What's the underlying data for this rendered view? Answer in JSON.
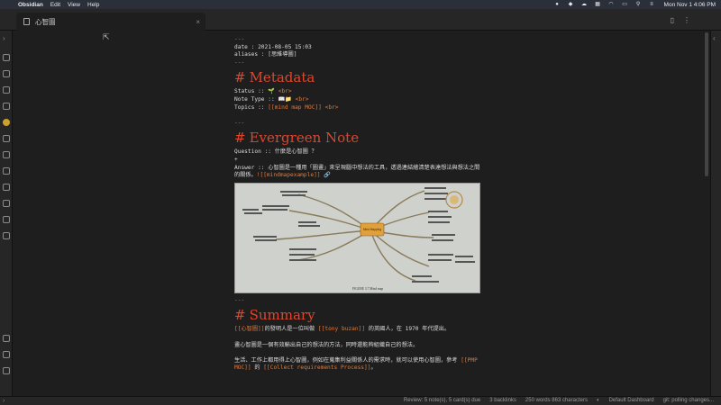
{
  "menubar": {
    "apple_icon": "apple-icon",
    "app_name": "Obsidian",
    "items": [
      "Edit",
      "View",
      "Help"
    ],
    "clock": "Mon Nov 1  4:06 PM"
  },
  "tab": {
    "title": "心智圖",
    "close": "×"
  },
  "note": {
    "frontmatter_open": "---",
    "date_line": "date : 2021-08-05 15:03",
    "aliases_line": "aliases : [思維導圖]",
    "frontmatter_close": "---",
    "h_metadata": "Metadata",
    "status_label": "Status :: ",
    "status_value": "🌱",
    "note_type_label": "Note Type :: ",
    "note_type_value": "📖📁",
    "topics_label": "Topics :: ",
    "topics_link": "[[mind map MOC]]",
    "br": "<br>",
    "sep1": "---",
    "h_evergreen": "Evergreen Note",
    "question_line": "Question :: 什麼是心智圖 ？",
    "plus": "+",
    "answer_line": "Answer :: 心智圖是一種用「圖畫」來呈現腦中想法的工具，透過連結繪清楚表達想法與想法之間的關係。",
    "answer_link": "![[mindmapexample]]",
    "sep2": "---",
    "h_summary": "Summary",
    "summary_1_link1": "[[心智圖]]",
    "summary_1_text1": "的發明人是一位叫做 ",
    "summary_1_link2": "[[tony buzan]]",
    "summary_1_text2": " 的英國人，在 1970 年代提出。",
    "summary_2": "畫心智圖是一個有效輸出自己的想法的方法，同時還能夠組織自己的想法。",
    "summary_3_text1": "生活、工作上都用得上心智圖，例如在蒐集利益關係人的需求時，就可以使用心智圖，參考 ",
    "summary_3_link1": "[[PMP MOC]]",
    "summary_3_text2": " 的 ",
    "summary_3_link2": "[[Collect requirements Process]]",
    "summary_3_text3": "。"
  },
  "mindmap_image": {
    "center_label": "Mind Mapping",
    "caption": "FIGURE 3.7   Mind map"
  },
  "statusbar": {
    "review": "Review: 5 note(s), 5 card(s) due",
    "backlinks": "3 backlinks",
    "counts": "250 words 863 characters",
    "dashboard": "Default Dashboard",
    "git": "git: polling changes..."
  },
  "colors": {
    "heading": "#e0452b",
    "link": "#e07a3a",
    "background": "#1e1e1e"
  }
}
